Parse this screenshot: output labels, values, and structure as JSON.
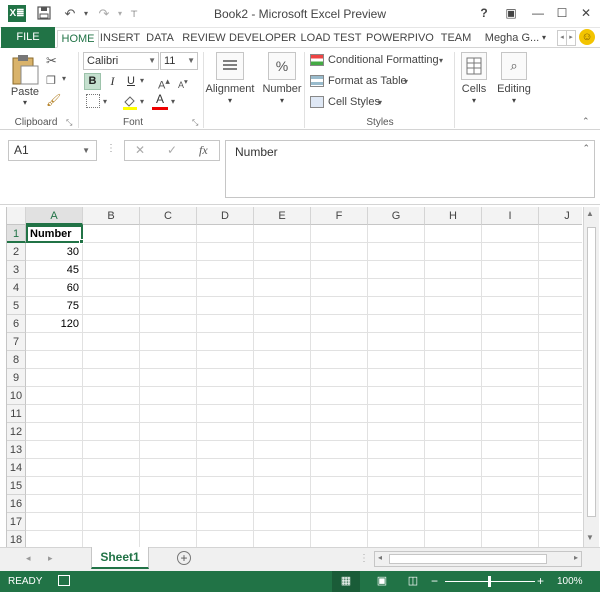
{
  "titlebar": {
    "app_icon": "X≣",
    "title": "Book2 - Microsoft Excel Preview",
    "help": "?",
    "restore": "▣",
    "minimize": "—",
    "maximize": "☐",
    "close": "✕"
  },
  "tabs": {
    "file": "FILE",
    "items": [
      "HOME",
      "INSERT",
      "DATA",
      "REVIEW",
      "DEVELOPER",
      "LOAD TEST",
      "POWERPIVO",
      "TEAM"
    ],
    "active": "HOME",
    "user": "Megha G...",
    "user_arrow": "▾"
  },
  "ribbon": {
    "clipboard": {
      "paste": "Paste",
      "label": "Clipboard"
    },
    "font": {
      "name": "Calibri",
      "size": "11",
      "bold": "B",
      "italic": "I",
      "underline": "U",
      "label": "Font",
      "font_color": "A"
    },
    "alignment": {
      "label": "Alignment"
    },
    "number": {
      "label": "Number",
      "icon": "%"
    },
    "styles": {
      "conditional": "Conditional Formatting",
      "format_table": "Format as Table",
      "cell_styles": "Cell Styles",
      "label": "Styles"
    },
    "cells": {
      "label": "Cells"
    },
    "editing": {
      "label": "Editing"
    }
  },
  "formula_bar": {
    "name_box": "A1",
    "fx": "fx",
    "content": "Number"
  },
  "grid": {
    "columns": [
      "A",
      "B",
      "C",
      "D",
      "E",
      "F",
      "G",
      "H",
      "I",
      "J"
    ],
    "rows": [
      "1",
      "2",
      "3",
      "4",
      "5",
      "6",
      "7",
      "8",
      "9",
      "10",
      "11",
      "12",
      "13",
      "14",
      "15",
      "16",
      "17",
      "18"
    ],
    "cells": {
      "A1": "Number",
      "A2": "30",
      "A3": "45",
      "A4": "60",
      "A5": "75",
      "A6": "120"
    }
  },
  "sheets": {
    "tabs": [
      "Sheet1"
    ],
    "active": "Sheet1",
    "add": "+"
  },
  "status": {
    "ready": "READY",
    "zoom": "100%",
    "zoom_minus": "−",
    "zoom_plus": "+"
  },
  "colors": {
    "accent": "#217346"
  }
}
